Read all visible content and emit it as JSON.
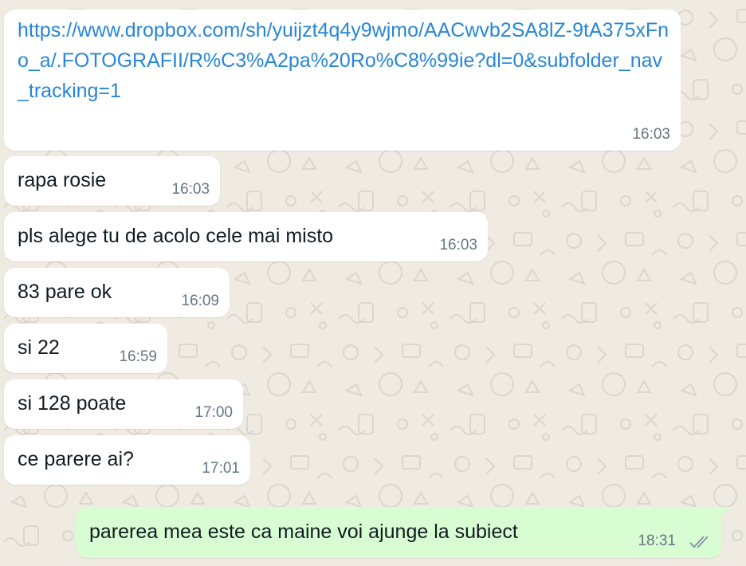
{
  "messages": [
    {
      "direction": "incoming",
      "type": "link",
      "text": "https://www.dropbox.com/sh/yuijzt4q4y9wjmo/AACwvb2SA8lZ-9tA375xFno_a/.FOTOGRAFII/R%C3%A2pa%20Ro%C8%99ie?dl=0&subfolder_nav_tracking=1",
      "time": "16:03"
    },
    {
      "direction": "incoming",
      "type": "text",
      "text": "rapa rosie",
      "time": "16:03"
    },
    {
      "direction": "incoming",
      "type": "text",
      "text": "pls alege tu de acolo cele mai misto",
      "time": "16:03"
    },
    {
      "direction": "incoming",
      "type": "text",
      "text": "83 pare ok",
      "time": "16:09"
    },
    {
      "direction": "incoming",
      "type": "text",
      "text": "si 22",
      "time": "16:59"
    },
    {
      "direction": "incoming",
      "type": "text",
      "text": "si 128 poate",
      "time": "17:00"
    },
    {
      "direction": "incoming",
      "type": "text",
      "text": "ce parere ai?",
      "time": "17:01"
    },
    {
      "direction": "outgoing",
      "type": "text",
      "text": "parerea mea este ca maine voi ajunge la subiect",
      "time": "18:31",
      "status_icon": "double-check-icon"
    }
  ],
  "colors": {
    "background": "#efeae2",
    "incoming_bubble": "#ffffff",
    "outgoing_bubble": "#d9fdd3",
    "link": "#2886d8",
    "timestamp": "#667781"
  }
}
